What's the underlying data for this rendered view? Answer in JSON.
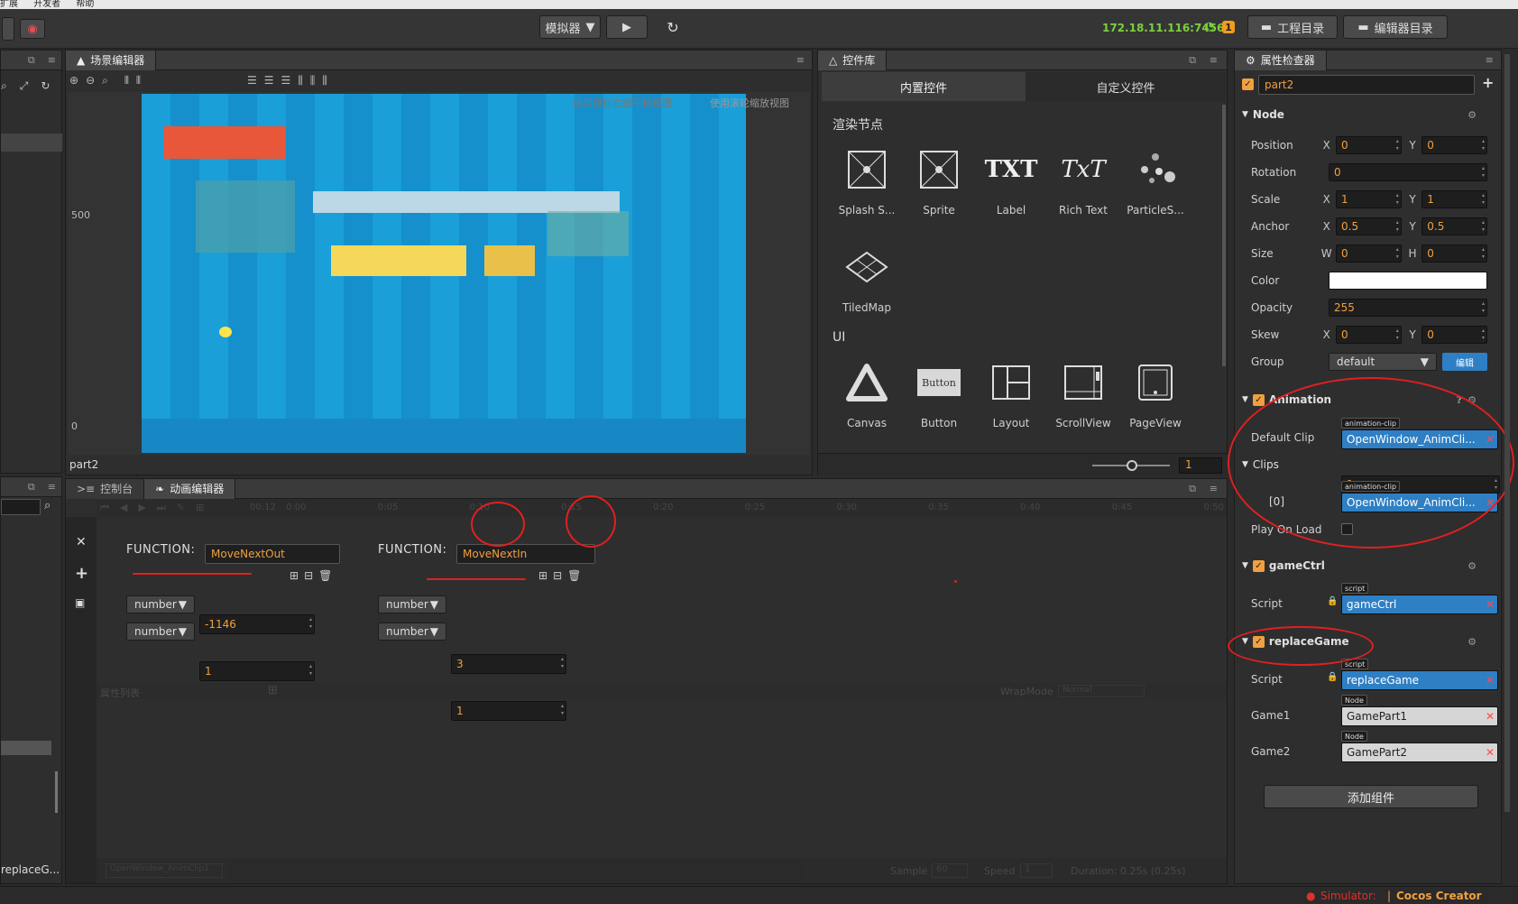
{
  "menu": {
    "items": [
      "扩展",
      "开发者",
      "帮助"
    ]
  },
  "toolbar": {
    "platform": "模拟器",
    "ip": "172.18.11.116:7456",
    "badge": "1",
    "project_btn": "工程目录",
    "editor_btn": "编辑器目录"
  },
  "scene": {
    "title": "场景编辑器",
    "hint_left": "使用鼠标右键平移视图",
    "hint_right": "使用滚轮缩放视图",
    "ruler_500": "500",
    "ruler_0": "0",
    "footer": "part2"
  },
  "library": {
    "title": "控件库",
    "tab_builtin": "内置控件",
    "tab_custom": "自定义控件",
    "section_render": "渲染节点",
    "section_ui": "UI",
    "render_items": [
      "Splash S...",
      "Sprite",
      "Label",
      "Rich Text",
      "ParticleS...",
      "TiledMap"
    ],
    "ui_items": [
      "Canvas",
      "Button",
      "Layout",
      "ScrollView",
      "PageView"
    ],
    "button_icon_text": "Button",
    "zoom_value": "1"
  },
  "inspector": {
    "title": "属性检查器",
    "node_name": "part2",
    "node_section": "Node",
    "position": {
      "label": "Position",
      "x": "0",
      "y": "0"
    },
    "rotation": {
      "label": "Rotation",
      "value": "0"
    },
    "scale": {
      "label": "Scale",
      "x": "1",
      "y": "1"
    },
    "anchor": {
      "label": "Anchor",
      "x": "0.5",
      "y": "0.5"
    },
    "size": {
      "label": "Size",
      "w": "0",
      "h": "0"
    },
    "color": {
      "label": "Color",
      "value": "#ffffff"
    },
    "opacity": {
      "label": "Opacity",
      "value": "255"
    },
    "skew": {
      "label": "Skew",
      "x": "0",
      "y": "0"
    },
    "group": {
      "label": "Group",
      "value": "default",
      "edit": "编辑"
    },
    "axis_x": "X",
    "axis_y": "Y",
    "axis_w": "W",
    "axis_h": "H",
    "animation": {
      "title": "Animation",
      "default_clip_label": "Default Clip",
      "clip_tag": "animation-clip",
      "default_clip": "OpenWindow_AnimCli...",
      "clips_label": "Clips",
      "clips_count": "1",
      "clip0_label": "[0]",
      "clip0": "OpenWindow_AnimCli...",
      "play_on_load": "Play On Load"
    },
    "gamectrl": {
      "title": "gameCtrl",
      "script_label": "Script",
      "tag": "script",
      "value": "gameCtrl"
    },
    "replacegame": {
      "title": "replaceGame",
      "script_label": "Script",
      "tag": "script",
      "value": "replaceGame",
      "game1_label": "Game1",
      "game1_tag": "Node",
      "game1": "GamePart1",
      "game2_label": "Game2",
      "game2_tag": "Node",
      "game2": "GamePart2"
    },
    "add_component": "添加组件"
  },
  "console": {
    "title": "控制台"
  },
  "animation_editor": {
    "title": "动画编辑器",
    "ticks": [
      "0:00",
      "0:05",
      "0:10",
      "0:15",
      "0:20",
      "0:25",
      "0:30",
      "0:35",
      "0:40",
      "0:45",
      "0:50"
    ],
    "time": "00:12",
    "func_label": "FUNCTION:",
    "func1": {
      "name": "MoveNextOut",
      "args": [
        {
          "type": "number",
          "value": "-1146"
        },
        {
          "type": "number",
          "value": "1"
        }
      ]
    },
    "func2": {
      "name": "MoveNextIn",
      "args": [
        {
          "type": "number",
          "value": "3"
        },
        {
          "type": "number",
          "value": "1"
        }
      ]
    },
    "prop_list": "属性列表",
    "wrapmode_label": "WrapMode",
    "wrapmode": "Normal",
    "clip_select": "OpenWindow_AnimClip1",
    "sample_label": "Sample",
    "sample": "60",
    "speed_label": "Speed",
    "speed": "1",
    "duration": "Duration: 0.25s (0.25s)"
  },
  "hierarchy": {
    "footer": "replaceG..."
  },
  "status": {
    "simulator": "Simulator:",
    "version": "Cocos Creator v2.0.4"
  }
}
